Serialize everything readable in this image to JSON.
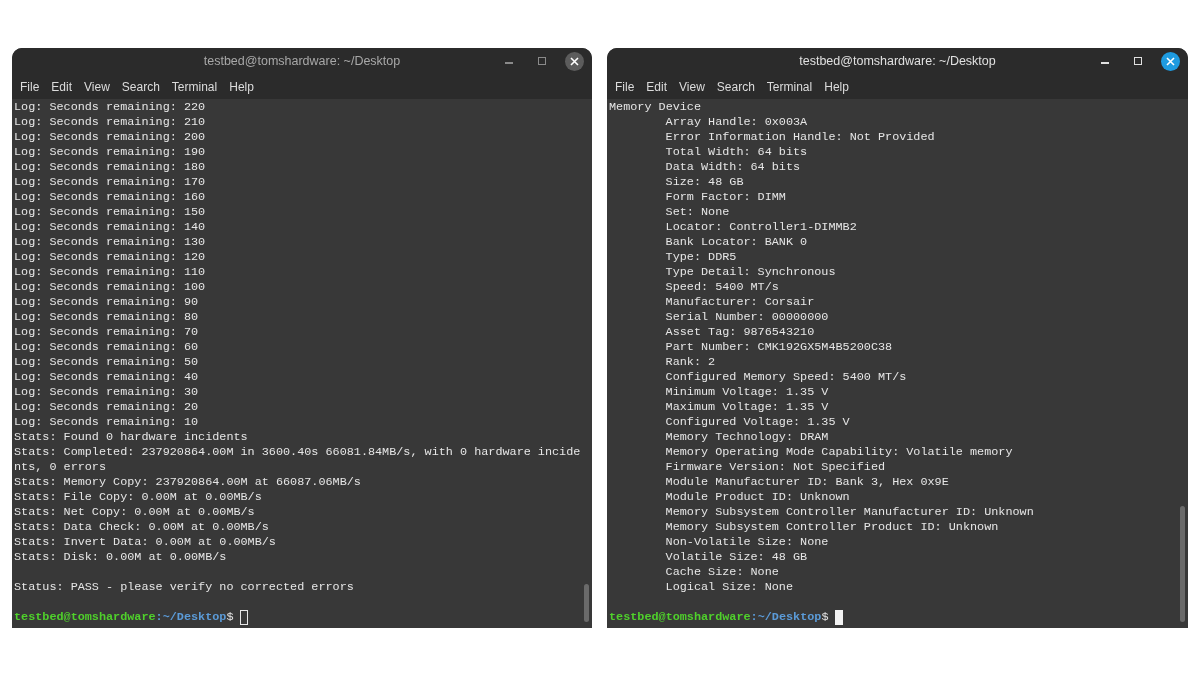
{
  "windows": [
    {
      "title": "testbed@tomshardware: ~/Desktop",
      "focused": false,
      "menu": [
        "File",
        "Edit",
        "View",
        "Search",
        "Terminal",
        "Help"
      ],
      "output": [
        {
          "text": "Log: Seconds remaining: 220"
        },
        {
          "text": "Log: Seconds remaining: 210"
        },
        {
          "text": "Log: Seconds remaining: 200"
        },
        {
          "text": "Log: Seconds remaining: 190"
        },
        {
          "text": "Log: Seconds remaining: 180"
        },
        {
          "text": "Log: Seconds remaining: 170"
        },
        {
          "text": "Log: Seconds remaining: 160"
        },
        {
          "text": "Log: Seconds remaining: 150"
        },
        {
          "text": "Log: Seconds remaining: 140"
        },
        {
          "text": "Log: Seconds remaining: 130"
        },
        {
          "text": "Log: Seconds remaining: 120"
        },
        {
          "text": "Log: Seconds remaining: 110"
        },
        {
          "text": "Log: Seconds remaining: 100"
        },
        {
          "text": "Log: Seconds remaining: 90"
        },
        {
          "text": "Log: Seconds remaining: 80"
        },
        {
          "text": "Log: Seconds remaining: 70"
        },
        {
          "text": "Log: Seconds remaining: 60"
        },
        {
          "text": "Log: Seconds remaining: 50"
        },
        {
          "text": "Log: Seconds remaining: 40"
        },
        {
          "text": "Log: Seconds remaining: 30"
        },
        {
          "text": "Log: Seconds remaining: 20"
        },
        {
          "text": "Log: Seconds remaining: 10"
        },
        {
          "text": "Stats: Found 0 hardware incidents"
        },
        {
          "text": "Stats: Completed: 237920864.00M in 3600.40s 66081.84MB/s, with 0 hardware incide"
        },
        {
          "text": "nts, 0 errors"
        },
        {
          "text": "Stats: Memory Copy: 237920864.00M at 66087.06MB/s"
        },
        {
          "text": "Stats: File Copy: 0.00M at 0.00MB/s"
        },
        {
          "text": "Stats: Net Copy: 0.00M at 0.00MB/s"
        },
        {
          "text": "Stats: Data Check: 0.00M at 0.00MB/s"
        },
        {
          "text": "Stats: Invert Data: 0.00M at 0.00MB/s"
        },
        {
          "text": "Stats: Disk: 0.00M at 0.00MB/s"
        }
      ],
      "status": "Status: PASS - please verify no corrected errors",
      "prompt": {
        "user_host": "testbed@tomshardware",
        "path": ":~/Desktop",
        "symbol": "$"
      }
    },
    {
      "title": "testbed@tomshardware: ~/Desktop",
      "focused": true,
      "menu": [
        "File",
        "Edit",
        "View",
        "Search",
        "Terminal",
        "Help"
      ],
      "output": [
        {
          "text": "Memory Device",
          "children": [
            {
              "text": "Array Handle: 0x003A"
            },
            {
              "text": "Error Information Handle: Not Provided"
            },
            {
              "text": "Total Width: 64 bits"
            },
            {
              "text": "Data Width: 64 bits"
            },
            {
              "text": "Size: 48 GB"
            },
            {
              "text": "Form Factor: DIMM"
            },
            {
              "text": "Set: None"
            },
            {
              "text": "Locator: Controller1-DIMMB2"
            },
            {
              "text": "Bank Locator: BANK 0"
            },
            {
              "text": "Type: DDR5"
            },
            {
              "text": "Type Detail: Synchronous"
            },
            {
              "text": "Speed: 5400 MT/s"
            },
            {
              "text": "Manufacturer: Corsair"
            },
            {
              "text": "Serial Number: 00000000"
            },
            {
              "text": "Asset Tag: 9876543210"
            },
            {
              "text": "Part Number: CMK192GX5M4B5200C38"
            },
            {
              "text": "Rank: 2"
            },
            {
              "text": "Configured Memory Speed: 5400 MT/s"
            },
            {
              "text": "Minimum Voltage: 1.35 V"
            },
            {
              "text": "Maximum Voltage: 1.35 V"
            },
            {
              "text": "Configured Voltage: 1.35 V"
            },
            {
              "text": "Memory Technology: DRAM"
            },
            {
              "text": "Memory Operating Mode Capability: Volatile memory"
            },
            {
              "text": "Firmware Version: Not Specified"
            },
            {
              "text": "Module Manufacturer ID: Bank 3, Hex 0x9E"
            },
            {
              "text": "Module Product ID: Unknown"
            },
            {
              "text": "Memory Subsystem Controller Manufacturer ID: Unknown"
            },
            {
              "text": "Memory Subsystem Controller Product ID: Unknown"
            },
            {
              "text": "Non-Volatile Size: None"
            },
            {
              "text": "Volatile Size: 48 GB"
            },
            {
              "text": "Cache Size: None"
            },
            {
              "text": "Logical Size: None"
            }
          ]
        }
      ],
      "prompt": {
        "user_host": "testbed@tomshardware",
        "path": ":~/Desktop",
        "symbol": "$"
      }
    }
  ]
}
